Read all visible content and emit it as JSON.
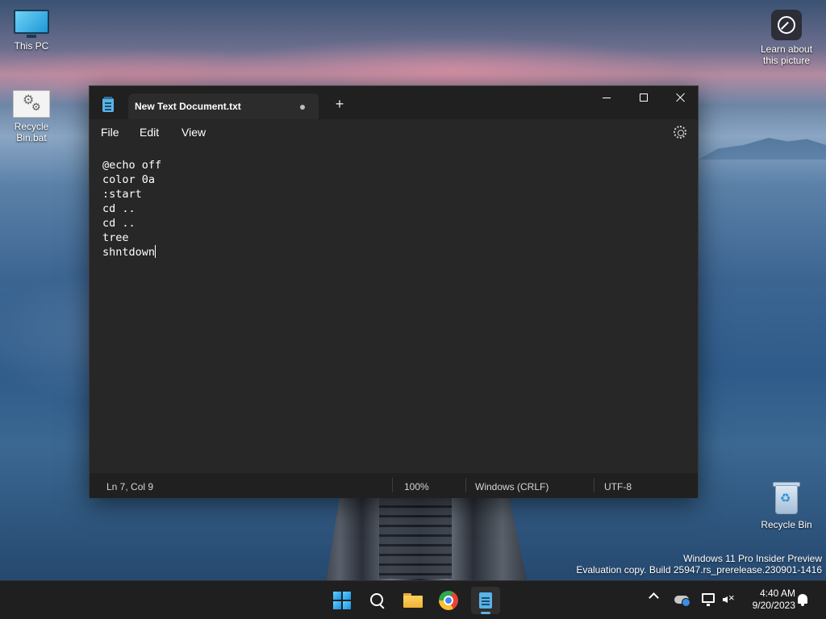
{
  "desktop": {
    "icons": [
      {
        "label": "This PC",
        "icon": "monitor-icon"
      },
      {
        "label": "Recycle Bin.bat",
        "icon": "batch-file-icon"
      },
      {
        "label": "Learn about this picture",
        "icon": "camera-info-icon"
      },
      {
        "label": "Recycle Bin",
        "icon": "recycle-bin-icon"
      }
    ],
    "watermark": {
      "line1": "Windows 11 Pro Insider Preview",
      "line2": "Evaluation copy. Build 25947.rs_prerelease.230901-1416"
    }
  },
  "notepad": {
    "tab_title": "New Text Document.txt",
    "unsaved_indicator": "•",
    "new_tab_label": "+",
    "menu": {
      "file": "File",
      "edit": "Edit",
      "view": "View"
    },
    "content": "@echo off\ncolor 0a\n:start\ncd ..\ncd ..\ntree\nshntdown",
    "status": {
      "position": "Ln 7, Col 9",
      "zoom": "100%",
      "line_endings": "Windows (CRLF)",
      "encoding": "UTF-8"
    },
    "accent_color": "#59b4e8"
  },
  "taskbar": {
    "apps": [
      "start-icon",
      "search-icon",
      "file-explorer-icon",
      "chrome-icon",
      "notepad-icon"
    ],
    "clock": {
      "time": "4:40 AM",
      "date": "9/20/2023"
    }
  }
}
